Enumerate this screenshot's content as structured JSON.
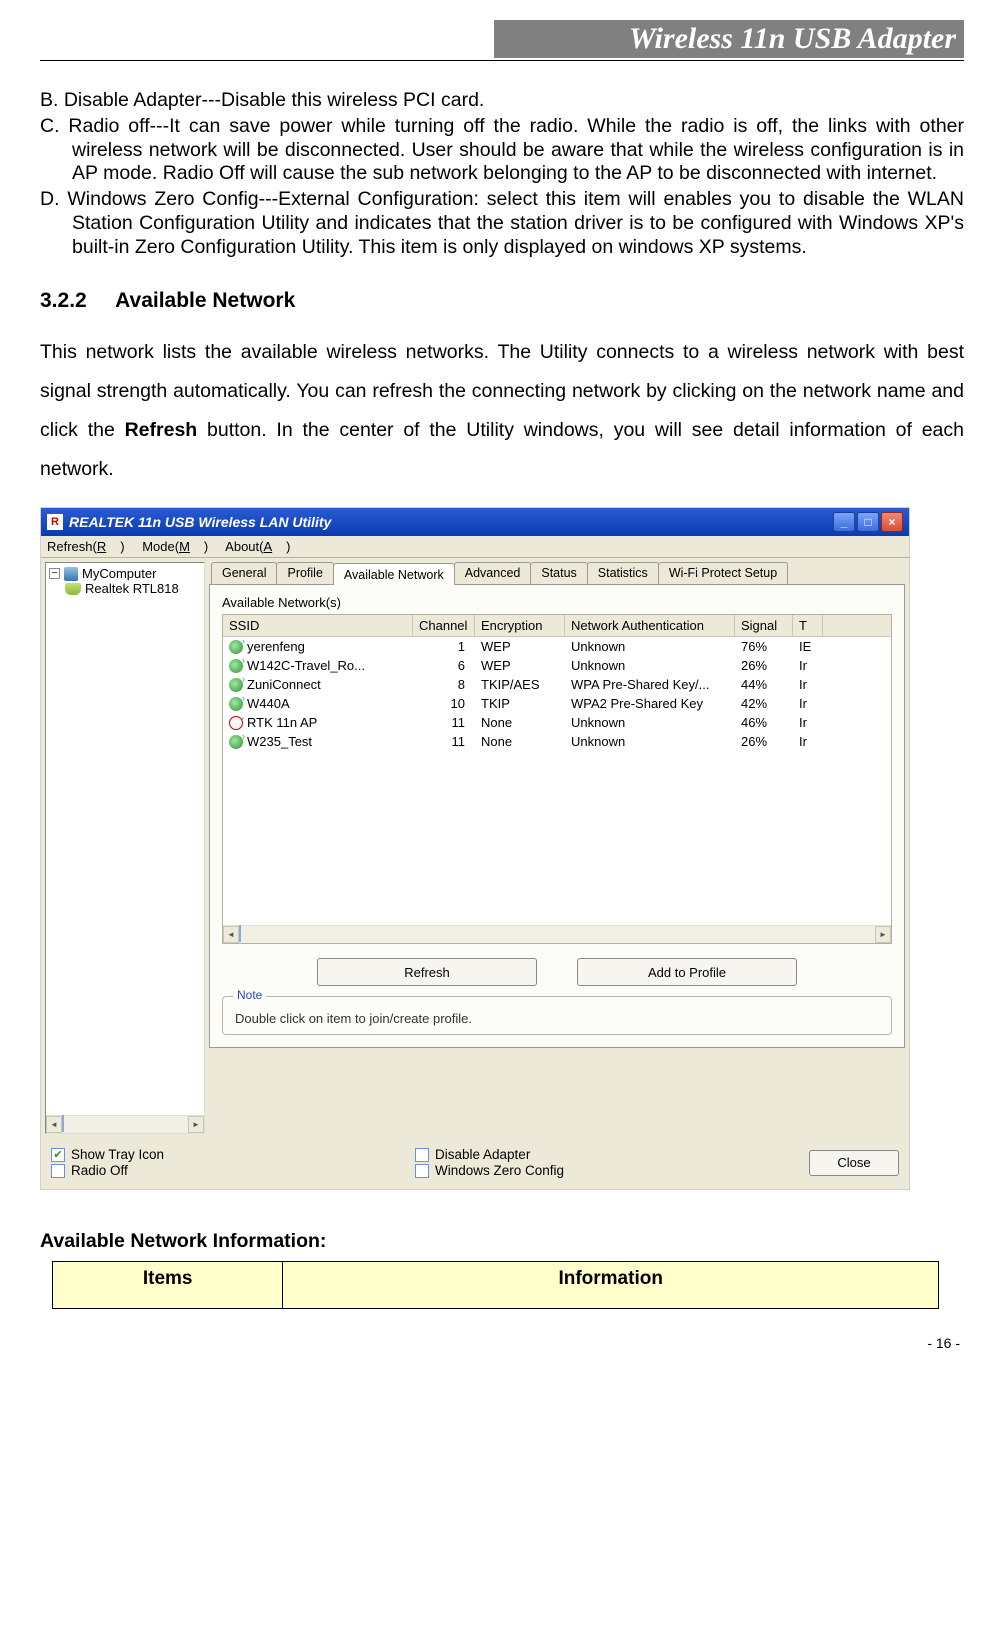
{
  "header": {
    "title": "Wireless 11n USB Adapter"
  },
  "paragraphs": {
    "b": "B. Disable Adapter---Disable this wireless PCI card.",
    "c": "C. Radio off---It can save power while turning off the radio. While the radio is off, the links with other wireless network will be disconnected. User should be aware that while the wireless configuration is in AP mode. Radio Off will cause the sub network belonging to the AP to be disconnected with internet.",
    "d": "D. Windows Zero Config---External Configuration: select this item will enables you to disable the WLAN Station Configuration Utility and indicates that the station driver is to be configured with Windows XP's built-in Zero Configuration Utility. This item is only displayed on windows XP systems."
  },
  "section": {
    "number": "3.2.2",
    "title": "Available Network",
    "body_a": "This network lists the available wireless networks. The Utility connects to a wireless network with best signal strength automatically. You can refresh the connecting network by clicking on the network name and click the ",
    "body_bold": "Refresh",
    "body_b": " button. In the center of the Utility windows, you will see detail information of each network."
  },
  "window": {
    "title": "REALTEK 11n USB Wireless LAN Utility",
    "menus": {
      "refresh": "Refresh(R)",
      "mode": "Mode(M)",
      "about": "About(A)"
    },
    "tree": {
      "root": "MyComputer",
      "child": "Realtek RTL818"
    },
    "tabs": [
      "General",
      "Profile",
      "Available Network",
      "Advanced",
      "Status",
      "Statistics",
      "Wi-Fi Protect Setup"
    ],
    "subhead": "Available Network(s)",
    "columns": [
      "SSID",
      "Channel",
      "Encryption",
      "Network Authentication",
      "Signal",
      "T"
    ],
    "rows": [
      {
        "icon": "g",
        "ssid": "yerenfeng",
        "ch": "1",
        "enc": "WEP",
        "auth": "Unknown",
        "sig": "76%",
        "t": "IE"
      },
      {
        "icon": "g",
        "ssid": "W142C-Travel_Ro...",
        "ch": "6",
        "enc": "WEP",
        "auth": "Unknown",
        "sig": "26%",
        "t": "Ir"
      },
      {
        "icon": "g",
        "ssid": "ZuniConnect",
        "ch": "8",
        "enc": "TKIP/AES",
        "auth": "WPA Pre-Shared Key/...",
        "sig": "44%",
        "t": "Ir"
      },
      {
        "icon": "g",
        "ssid": "W440A",
        "ch": "10",
        "enc": "TKIP",
        "auth": "WPA2 Pre-Shared Key",
        "sig": "42%",
        "t": "Ir"
      },
      {
        "icon": "r",
        "ssid": "RTK 11n AP",
        "ch": "11",
        "enc": "None",
        "auth": "Unknown",
        "sig": "46%",
        "t": "Ir"
      },
      {
        "icon": "g",
        "ssid": "W235_Test",
        "ch": "11",
        "enc": "None",
        "auth": "Unknown",
        "sig": "26%",
        "t": "Ir"
      }
    ],
    "buttons": {
      "refresh": "Refresh",
      "add": "Add to Profile"
    },
    "note_legend": "Note",
    "note_text": "Double click on item to join/create profile.",
    "checks": {
      "show_tray": "Show Tray Icon",
      "radio_off": "Radio Off",
      "disable_adapter": "Disable Adapter",
      "zero_config": "Windows Zero Config"
    },
    "close": "Close"
  },
  "after": {
    "heading": "Available Network Information:"
  },
  "table": {
    "h1": "Items",
    "h2": "Information"
  },
  "pageno": "- 16 -"
}
